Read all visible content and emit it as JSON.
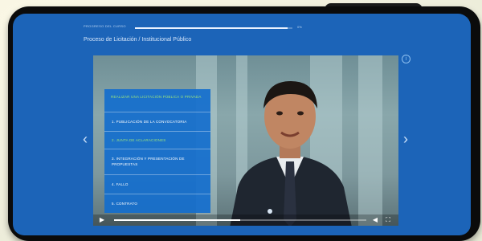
{
  "course": {
    "progress_label": "PROGRESO DEL CURSO",
    "progress_fraction": 0.97,
    "progress_percent_text": "0%",
    "title": "Proceso de Licitación / Institucional Público"
  },
  "video": {
    "playback_fraction": 0.5,
    "menu": {
      "header": "REALIZAR UNA LICITACIÓN PÚBLICA O PRIVADA",
      "items": [
        {
          "label": "1. PUBLICACIÓN DE LA CONVOCATORIA",
          "active": false
        },
        {
          "label": "2. JUNTA DE ACLARACIONES",
          "active": true
        },
        {
          "label": "3. INTEGRACIÓN Y PRESENTACIÓN DE PROPUESTAS",
          "active": false
        },
        {
          "label": "4. FALLO",
          "active": false
        },
        {
          "label": "5. CONTRATO",
          "active": false
        }
      ]
    }
  },
  "icons": {
    "info": "info-icon",
    "prev": "chevron-left-icon",
    "next": "chevron-right-icon",
    "play": "play-icon",
    "volume": "volume-icon",
    "fullscreen": "fullscreen-icon"
  },
  "colors": {
    "screen_blue": "#1c64b8",
    "menu_blue": "#146ecd",
    "active_green": "#9be37c"
  }
}
